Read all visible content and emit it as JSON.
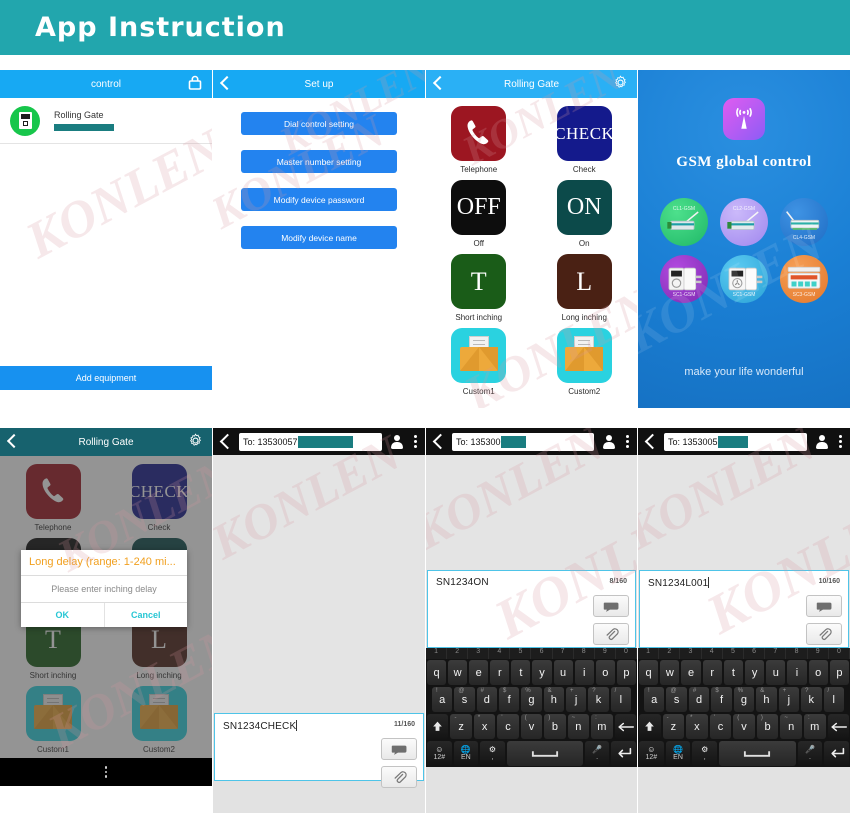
{
  "banner": {
    "title": "App  Instruction",
    "bg": "#22a6ad"
  },
  "watermark": {
    "text": "KONLEN"
  },
  "panel_control": {
    "appbar_title": "control",
    "lock_icon": "lock-icon",
    "device": {
      "name": "Rolling Gate",
      "number_redacted": ""
    },
    "add_button": "Add equipment"
  },
  "panel_setup": {
    "appbar_title": "Set up",
    "back_icon": "chevron-left-icon",
    "buttons": [
      "Dial control setting",
      "Master number setting",
      "Modify device password",
      "Modify device name"
    ]
  },
  "panel_gate": {
    "appbar_title": "Rolling Gate",
    "back_icon": "chevron-left-icon",
    "gear_icon": "gear-icon",
    "tiles": [
      {
        "glyph": "",
        "label": "Telephone",
        "kind": "t-tel",
        "color": "#9c1621"
      },
      {
        "glyph": "CHECK",
        "label": "Check",
        "kind": "t-check",
        "color": "#141a8c"
      },
      {
        "glyph": "OFF",
        "label": "Off",
        "kind": "t-off",
        "color": "#0d0d0d"
      },
      {
        "glyph": "ON",
        "label": "On",
        "kind": "t-on",
        "color": "#0c4a4a"
      },
      {
        "glyph": "T",
        "label": "Short inching",
        "kind": "t-short",
        "color": "#1a5c18"
      },
      {
        "glyph": "L",
        "label": "Long inching",
        "kind": "t-long",
        "color": "#4a2114"
      },
      {
        "glyph": "",
        "label": "Custom1",
        "kind": "t-mail",
        "color": "#2ad2e0"
      },
      {
        "glyph": "",
        "label": "Custom2",
        "kind": "t-mail",
        "color": "#2ad2e0"
      }
    ]
  },
  "panel_gsm": {
    "logo_icon": "signal-tower-icon",
    "title": "GSM global control",
    "tagline": "make your life wonderful",
    "products": [
      {
        "label": "CL1-GSM",
        "color1": "#36d17a",
        "color2": "#1fb867",
        "label_pos": "top"
      },
      {
        "label": "CL2-GSM",
        "color1": "#b9a4f4",
        "color2": "#9f87ee",
        "label_pos": "top"
      },
      {
        "label": "CL4-GSM",
        "color1": "#2a7fd8",
        "color2": "#1f6dc4",
        "label_pos": "bottom"
      },
      {
        "label": "SC1-GSM",
        "color1": "#9437c9",
        "color2": "#7d2bb0",
        "label_pos": "bottom"
      },
      {
        "label": "SC1-GSM",
        "color1": "#39b8e8",
        "color2": "#2aa2d6",
        "label_pos": "bottom"
      },
      {
        "label": "SC3-GSM",
        "color1": "#f08a34",
        "color2": "#e3772a",
        "label_pos": "bottom"
      }
    ]
  },
  "panel_dialog": {
    "appbar_title": "Rolling Gate",
    "back_icon": "chevron-left-icon",
    "gear_icon": "gear-icon",
    "dialog": {
      "title": "Long delay (range: 1-240 mi...",
      "input_placeholder": "Please enter inching delay",
      "ok": "OK",
      "cancel": "Cancel"
    },
    "tiles": [
      {
        "glyph": "",
        "label": "Telephone",
        "kind": "t-tel"
      },
      {
        "glyph": "CHECK",
        "label": "Check",
        "kind": "t-check"
      },
      {
        "glyph": "OFF",
        "label": "Off",
        "kind": "t-off"
      },
      {
        "glyph": "ON",
        "label": "On",
        "kind": "t-on"
      },
      {
        "glyph": "T",
        "label": "Short inching",
        "kind": "t-short"
      },
      {
        "glyph": "L",
        "label": "Long inching",
        "kind": "t-long"
      },
      {
        "glyph": "",
        "label": "Custom1",
        "kind": "t-mail"
      },
      {
        "glyph": "",
        "label": "Custom2",
        "kind": "t-mail"
      }
    ],
    "nav_icon": "menu-dots-icon"
  },
  "sms_check": {
    "to_label": "To: 13530057",
    "to_redact_width": 55,
    "message": "SN1234CHECK",
    "counter": "11/160",
    "send_icon": "send-icon",
    "attach_icon": "paperclip-icon",
    "contact_icon": "contact-icon",
    "overflow_icon": "overflow-menu-icon",
    "keyboard": false
  },
  "sms_on": {
    "to_label": "To: 135300",
    "to_redact_width": 60,
    "message": "SN1234ON",
    "counter": "8/160",
    "send_icon": "send-icon",
    "attach_icon": "paperclip-icon",
    "contact_icon": "contact-icon",
    "overflow_icon": "overflow-menu-icon",
    "keyboard": true
  },
  "sms_long": {
    "to_label": "To: 1353005",
    "to_redact_width": 55,
    "message": "SN1234L001",
    "counter": "10/160",
    "send_icon": "send-icon",
    "attach_icon": "paperclip-icon",
    "contact_icon": "contact-icon",
    "overflow_icon": "overflow-menu-icon",
    "keyboard": true
  },
  "keyboard": {
    "numrow": [
      "1",
      "2",
      "3",
      "4",
      "5",
      "6",
      "7",
      "8",
      "9",
      "0"
    ],
    "row1": [
      "q",
      "w",
      "e",
      "r",
      "t",
      "y",
      "u",
      "i",
      "o",
      "p"
    ],
    "row1_sup": [
      "1",
      "2",
      "3",
      "4",
      "5",
      "6",
      "7",
      "8",
      "9",
      "0"
    ],
    "row2": [
      "a",
      "s",
      "d",
      "f",
      "g",
      "h",
      "j",
      "k",
      "l"
    ],
    "row2_sup": [
      "!",
      "@",
      "#",
      "$",
      "%",
      "&",
      "+",
      "?",
      "/"
    ],
    "row3": [
      "z",
      "x",
      "c",
      "v",
      "b",
      "n",
      "m"
    ],
    "row3_sup": [
      "-",
      "*",
      "'",
      "(",
      ")",
      "~",
      ":"
    ],
    "shift_icon": "shift-up-icon",
    "backspace_icon": "backspace-icon",
    "sym_key": "12#",
    "sym_icon": "emoji-icon",
    "lang_key": "EN",
    "lang_icon": "globe-icon",
    "settings_key": ",",
    "settings_icon": "gear-icon",
    "space_icon": "space-bar-icon",
    "mic_key": ".",
    "mic_icon": "microphone-icon",
    "enter_icon": "enter-icon"
  }
}
